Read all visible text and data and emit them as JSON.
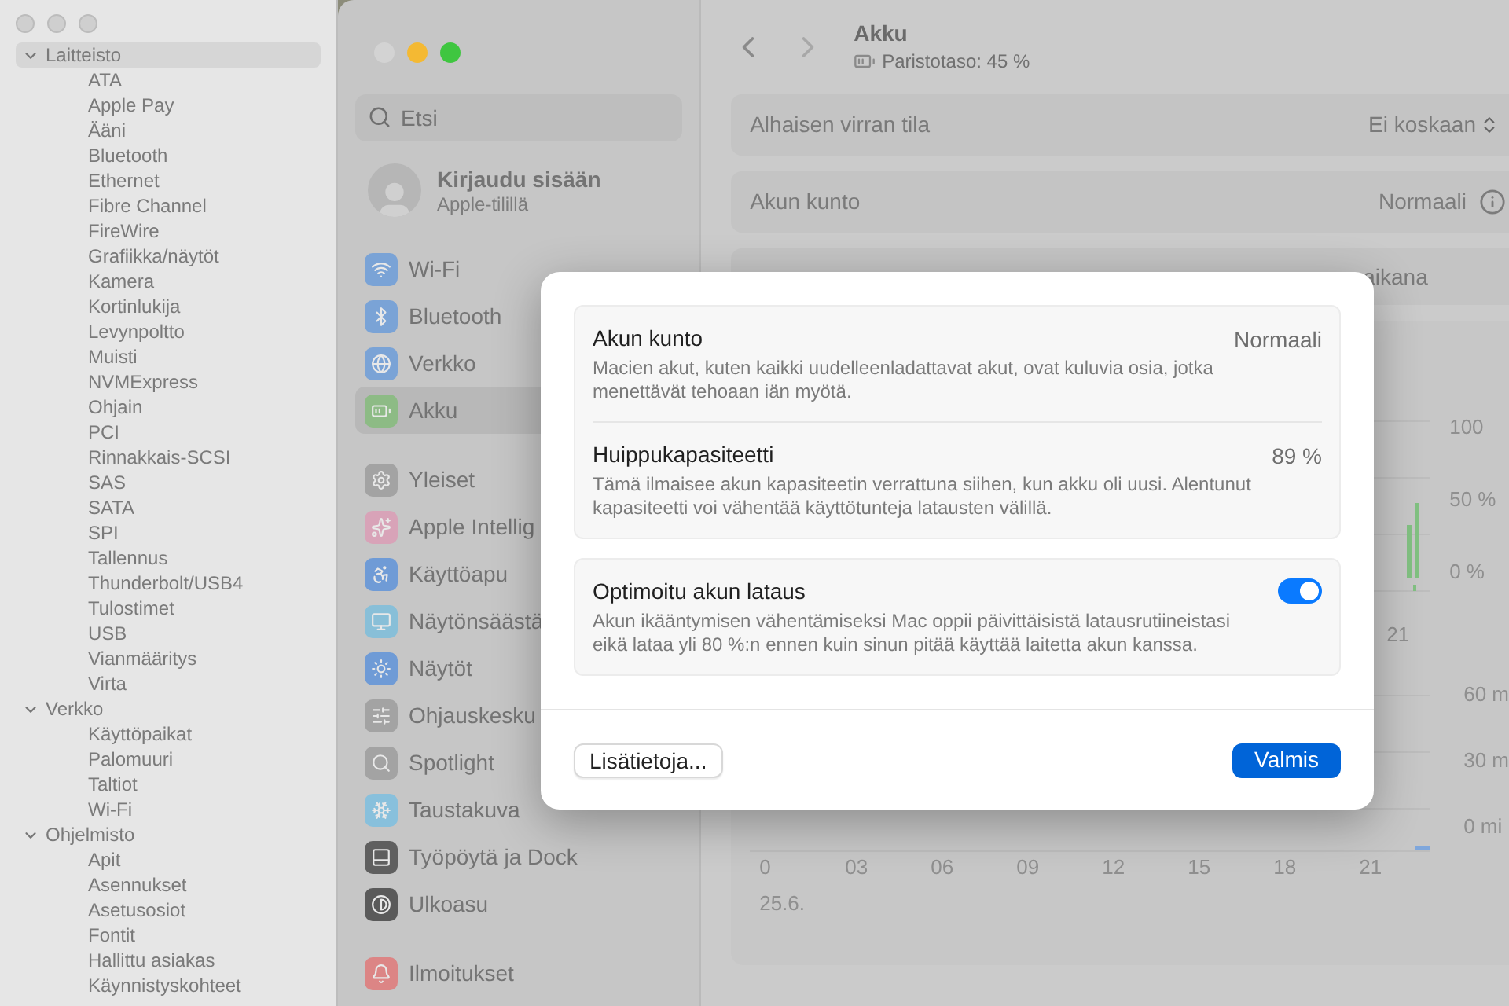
{
  "info_window": {
    "tree": [
      {
        "label": "Laitteisto",
        "expanded": true,
        "selected": true,
        "children": [
          {
            "label": "ATA",
            "selected": false
          },
          {
            "label": "Apple Pay",
            "selected": false
          },
          {
            "label": "Ääni",
            "selected": false
          },
          {
            "label": "Bluetooth",
            "selected": false
          },
          {
            "label": "Ethernet",
            "selected": false
          },
          {
            "label": "Fibre Channel",
            "selected": false
          },
          {
            "label": "FireWire",
            "selected": false
          },
          {
            "label": "Grafiikka/näytöt",
            "selected": false
          },
          {
            "label": "Kamera",
            "selected": false
          },
          {
            "label": "Kortinlukija",
            "selected": false
          },
          {
            "label": "Levynpoltto",
            "selected": false
          },
          {
            "label": "Muisti",
            "selected": false
          },
          {
            "label": "NVMExpress",
            "selected": false
          },
          {
            "label": "Ohjain",
            "selected": false
          },
          {
            "label": "PCI",
            "selected": false
          },
          {
            "label": "Rinnakkais-SCSI",
            "selected": false
          },
          {
            "label": "SAS",
            "selected": false
          },
          {
            "label": "SATA",
            "selected": false
          },
          {
            "label": "SPI",
            "selected": false
          },
          {
            "label": "Tallennus",
            "selected": false
          },
          {
            "label": "Thunderbolt/USB4",
            "selected": false
          },
          {
            "label": "Tulostimet",
            "selected": false
          },
          {
            "label": "USB",
            "selected": false
          },
          {
            "label": "Vianmääritys",
            "selected": false
          },
          {
            "label": "Virta",
            "selected": false
          }
        ]
      },
      {
        "label": "Verkko",
        "expanded": true,
        "selected": false,
        "children": [
          {
            "label": "Käyttöpaikat",
            "selected": false
          },
          {
            "label": "Palomuuri",
            "selected": false
          },
          {
            "label": "Taltiot",
            "selected": false
          },
          {
            "label": "Wi-Fi",
            "selected": false
          }
        ]
      },
      {
        "label": "Ohjelmisto",
        "expanded": true,
        "selected": false,
        "children": [
          {
            "label": "Apit",
            "selected": false
          },
          {
            "label": "Asennukset",
            "selected": false
          },
          {
            "label": "Asetusosiot",
            "selected": false
          },
          {
            "label": "Fontit",
            "selected": false
          },
          {
            "label": "Hallittu asiakas",
            "selected": false
          },
          {
            "label": "Käynnistyskohteet",
            "selected": false
          }
        ]
      }
    ]
  },
  "settings_window": {
    "search": {
      "placeholder": "Etsi"
    },
    "account": {
      "title": "Kirjaudu sisään",
      "subtitle": "Apple-tilillä"
    },
    "sidebar": {
      "groups": [
        [
          {
            "label": "Wi-Fi",
            "color": "#7aa3d6",
            "selected": false
          },
          {
            "label": "Bluetooth",
            "color": "#7aa3d6",
            "selected": false
          },
          {
            "label": "Verkko",
            "color": "#7aa3d6",
            "selected": false
          },
          {
            "label": "Akku",
            "color": "#8dbb85",
            "selected": true
          }
        ],
        [
          {
            "label": "Yleiset",
            "color": "#a3a3a3",
            "selected": false
          },
          {
            "label": "Apple Intellig",
            "color": "#d8a3b8",
            "selected": false
          },
          {
            "label": "Käyttöapu",
            "color": "#6f9bd6",
            "selected": false
          },
          {
            "label": "Näytönsäästä",
            "color": "#88bfd8",
            "selected": false
          },
          {
            "label": "Näytöt",
            "color": "#6f9bd6",
            "selected": false
          },
          {
            "label": "Ohjauskesku",
            "color": "#a3a3a3",
            "selected": false
          },
          {
            "label": "Spotlight",
            "color": "#a3a3a3",
            "selected": false
          },
          {
            "label": "Taustakuva",
            "color": "#88c0dc",
            "selected": false
          },
          {
            "label": "Työpöytä ja Dock",
            "color": "#5f5f5f",
            "selected": false
          },
          {
            "label": "Ulkoasu",
            "color": "#5a5a5a",
            "selected": false
          }
        ],
        [
          {
            "label": "Ilmoitukset",
            "color": "#dc8585",
            "selected": false
          }
        ]
      ]
    },
    "header": {
      "title": "Akku",
      "subtitle": "Paristotaso: 45 %"
    },
    "rows": [
      {
        "kind": "select",
        "label": "Alhaisen virran tila",
        "value": "Ei koskaan"
      },
      {
        "kind": "info",
        "label": "Akun kunto",
        "value": "Normaali"
      },
      {
        "kind": "segment",
        "value": "aikana"
      }
    ],
    "level_chart": {
      "y_labels": [
        "100",
        "50 %",
        "0 %"
      ],
      "x_labels": [
        "21"
      ]
    },
    "usage_chart": {
      "y_labels": [
        "60 m",
        "30 m",
        "0 mi"
      ],
      "x_labels": [
        "0",
        "03",
        "06",
        "09",
        "12",
        "15",
        "18",
        "21"
      ],
      "date": "25.6."
    }
  },
  "dialog": {
    "sections": [
      {
        "title": "Akun kunto",
        "value": "Normaali",
        "description": "Macien akut, kuten kaikki uudelleenladattavat akut, ovat kuluvia osia, jotka menettävät tehoaan iän myötä."
      },
      {
        "title": "Huippukapasiteetti",
        "value": "89 %",
        "description": "Tämä ilmaisee akun kapasiteetin verrattuna siihen, kun akku oli uusi. Alentunut kapasiteetti voi vähentää käyttötunteja latausten välillä."
      },
      {
        "title": "Optimoitu akun lataus",
        "checked": true,
        "description": "Akun ikääntymisen vähentämiseksi Mac oppii päivittäisistä latausrutiineistasi eikä lataa yli 80 %:n ennen kuin sinun pitää käyttää laitetta akun kanssa."
      }
    ],
    "buttons": [
      {
        "label": "Lisätietoja...",
        "primary": false
      },
      {
        "label": "Valmis",
        "primary": true
      }
    ]
  }
}
